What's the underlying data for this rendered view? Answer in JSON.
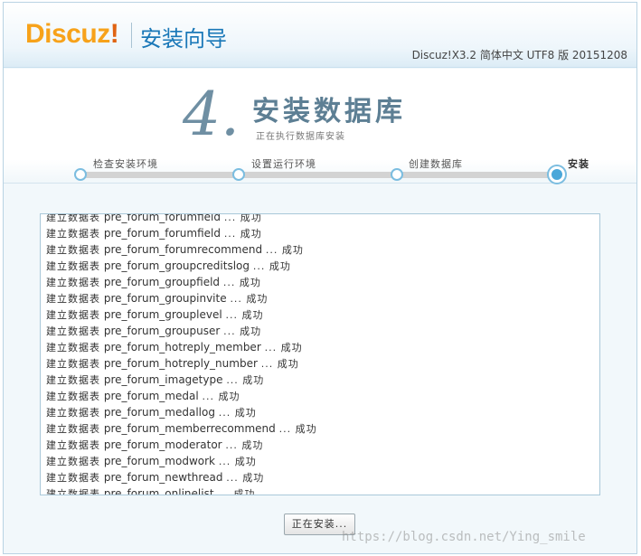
{
  "header": {
    "logo_text": "Discuz",
    "logo_bang": "!",
    "wizard_title": "安装向导",
    "version": "Discuz!X3.2 简体中文 UTF8 版 20151208"
  },
  "step": {
    "number": "4.",
    "title": "安装数据库",
    "subtitle": "正在执行数据库安装"
  },
  "steps": [
    {
      "label": "检查安装环境",
      "state": "done"
    },
    {
      "label": "设置运行环境",
      "state": "done"
    },
    {
      "label": "创建数据库",
      "state": "done"
    },
    {
      "label": "安装",
      "state": "current"
    }
  ],
  "log": {
    "prefix": "建立数据表",
    "suffix": "... 成功",
    "tables": [
      "pre_forum_forumfield",
      "pre_forum_forumfield",
      "pre_forum_forumrecommend",
      "pre_forum_groupcreditslog",
      "pre_forum_groupfield",
      "pre_forum_groupinvite",
      "pre_forum_grouplevel",
      "pre_forum_groupuser",
      "pre_forum_hotreply_member",
      "pre_forum_hotreply_number",
      "pre_forum_imagetype",
      "pre_forum_medal",
      "pre_forum_medallog",
      "pre_forum_memberrecommend",
      "pre_forum_moderator",
      "pre_forum_modwork",
      "pre_forum_newthread",
      "pre_forum_onlinelist"
    ]
  },
  "install_button": "正在安装...",
  "watermark": "https://blog.csdn.net/Ying_smile"
}
